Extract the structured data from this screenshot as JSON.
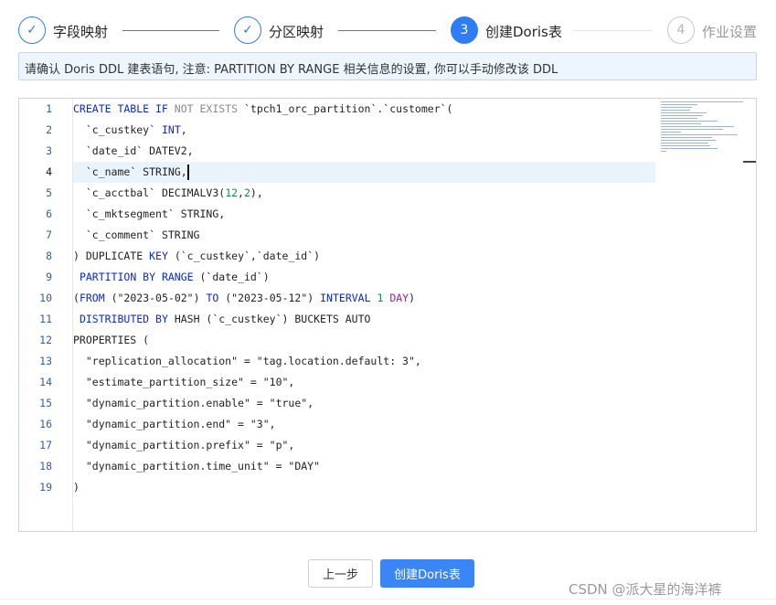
{
  "steps": [
    {
      "label": "字段映射",
      "state": "done"
    },
    {
      "label": "分区映射",
      "state": "done"
    },
    {
      "label": "创建Doris表",
      "number": "3",
      "state": "active"
    },
    {
      "label": "作业设置",
      "number": "4",
      "state": "todo"
    }
  ],
  "icons": {
    "check": "✓"
  },
  "notice": "请确认 Doris DDL 建表语句, 注意: PARTITION BY RANGE 相关信息的设置, 你可以手动修改该 DDL",
  "editor": {
    "line_numbers": [
      "1",
      "2",
      "3",
      "4",
      "5",
      "6",
      "7",
      "8",
      "9",
      "10",
      "11",
      "12",
      "13",
      "14",
      "15",
      "16",
      "17",
      "18",
      "19"
    ],
    "current_line": 4
  },
  "code": {
    "l1": {
      "k1": "CREATE TABLE IF",
      "k2": "NOT EXISTS",
      "t": "`tpch1_orc_partition`.`customer`("
    },
    "l2": {
      "t": "`c_custkey`",
      "k": "INT",
      "p": ","
    },
    "l3": {
      "t": "`date_id` DATEV2,"
    },
    "l4": {
      "t": "`c_name` STRING,"
    },
    "l5": {
      "t": "`c_acctbal` DECIMALV3(",
      "n1": "12",
      "c": ",",
      "n2": "2",
      "p": "),"
    },
    "l6": {
      "t": "`c_mktsegment` STRING,"
    },
    "l7": {
      "t": "`c_comment` STRING"
    },
    "l8": {
      "a": ") DUPLICATE",
      "k": "KEY",
      "b": "(`c_custkey`,`date_id`)"
    },
    "l9": {
      "k": "PARTITION BY RANGE",
      "t": "(`date_id`)"
    },
    "l10": {
      "k1": "FROM",
      "s1": "(\"2023-05-02\")",
      "k2": "TO",
      "s2": "(\"2023-05-12\")",
      "k3": "INTERVAL",
      "n": "1",
      "k4": "DAY",
      "p": ")"
    },
    "l11": {
      "k": "DISTRIBUTED BY",
      "t": "HASH (`c_custkey`) BUCKETS AUTO"
    },
    "l12": {
      "t": "PROPERTIES ("
    },
    "l13": {
      "t": "\"replication_allocation\" = \"tag.location.default: 3\","
    },
    "l14": {
      "t": "\"estimate_partition_size\" = \"10\","
    },
    "l15": {
      "t": "\"dynamic_partition.enable\" = \"true\","
    },
    "l16": {
      "t": "\"dynamic_partition.end\" = \"3\","
    },
    "l17": {
      "t": "\"dynamic_partition.prefix\" = \"p\","
    },
    "l18": {
      "t": "\"dynamic_partition.time_unit\" = \"DAY\""
    },
    "l19": {
      "t": ")"
    }
  },
  "buttons": {
    "prev": "上一步",
    "create": "创建Doris表"
  },
  "watermark": "CSDN @派大星的海洋裤"
}
